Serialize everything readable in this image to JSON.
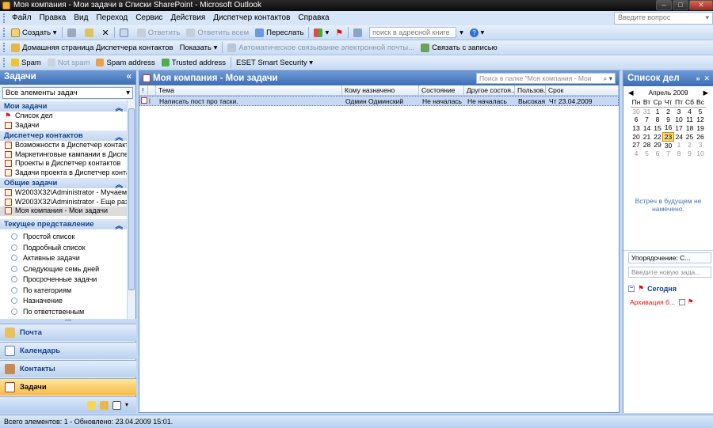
{
  "window": {
    "title": "Моя компания - Мои задачи в Списки SharePoint - Microsoft Outlook"
  },
  "menu": {
    "items": [
      "Файл",
      "Правка",
      "Вид",
      "Переход",
      "Сервис",
      "Действия",
      "Диспетчер контактов",
      "Справка"
    ],
    "ask_placeholder": "Введите вопрос"
  },
  "toolbar1": {
    "create": "Создать",
    "reply": "Ответить",
    "reply_all": "Ответить всем",
    "forward": "Переслать",
    "address_search": "поиск в адресной книге"
  },
  "toolbar2": {
    "home_page": "Домашняя страница Диспетчера контактов",
    "show": "Показать",
    "auto_link": "Автоматическое связывание электронной почты...",
    "link_record": "Связать с записью"
  },
  "toolbar3": {
    "spam": "Spam",
    "not_spam": "Not spam",
    "spam_address": "Spam address",
    "trusted_address": "Trusted address",
    "eset": "ESET Smart Security"
  },
  "nav": {
    "title": "Задачи",
    "folder_select": "Все элементы задач",
    "groups": [
      {
        "title": "Мои задачи",
        "items": [
          "Список дел",
          "Задачи"
        ]
      },
      {
        "title": "Диспетчер контактов",
        "items": [
          "Возможности в Диспетчер контактов",
          "Маркетинговые кампании в Диспетче",
          "Проекты в Диспетчер контактов",
          "Задачи проекта в Диспетчер контакт"
        ]
      },
      {
        "title": "Общие задачи",
        "items": [
          "W2003X32\\Administrator - Мучаем ста",
          "W2003X32\\Administrator - Еще раз тес",
          "Моя компания - Мои задачи"
        ]
      }
    ],
    "view_title": "Текущее представление",
    "views": [
      "Простой список",
      "Подробный список",
      "Активные задачи",
      "Следующие семь дней",
      "Просроченные задачи",
      "По категориям",
      "Назначение",
      "По ответственным"
    ],
    "buttons": [
      "Почта",
      "Календарь",
      "Контакты",
      "Задачи"
    ]
  },
  "main": {
    "title": "Моя компания - Мои задачи",
    "search_placeholder": "Поиск в папке \"Моя компания - Мои",
    "columns": [
      "Тема",
      "Кому назначено",
      "Состояние",
      "Другое состоя...",
      "Пользов...",
      "Срок"
    ],
    "rows": [
      {
        "subject": "Написать пост про таски.",
        "assigned": "Одмин Одминский",
        "status": "Не началась",
        "other_status": "Не началась",
        "priority": "Высокая",
        "due": "Чт 23.04.2009"
      }
    ]
  },
  "todo": {
    "title": "Список дел",
    "month": "Апрель 2009",
    "weekdays": [
      "Пн",
      "Вт",
      "Ср",
      "Чт",
      "Пт",
      "Сб",
      "Вс"
    ],
    "weeks": [
      [
        "30",
        "31",
        "1",
        "2",
        "3",
        "4",
        "5"
      ],
      [
        "6",
        "7",
        "8",
        "9",
        "10",
        "11",
        "12"
      ],
      [
        "13",
        "14",
        "15",
        "16",
        "17",
        "18",
        "19"
      ],
      [
        "20",
        "21",
        "22",
        "23",
        "24",
        "25",
        "26"
      ],
      [
        "27",
        "28",
        "29",
        "30",
        "1",
        "2",
        "3"
      ],
      [
        "4",
        "5",
        "6",
        "7",
        "8",
        "9",
        "10"
      ]
    ],
    "today": "23",
    "appointments": "Встреч в будущем не намечено.",
    "arrange": "Упорядочение: С...",
    "new_task_placeholder": "Введите новую зада...",
    "group": "Сегодня",
    "task": "Архивация б..."
  },
  "status": {
    "text": "Всего элементов: 1 - Обновлено: 23.04.2009 15:01."
  }
}
